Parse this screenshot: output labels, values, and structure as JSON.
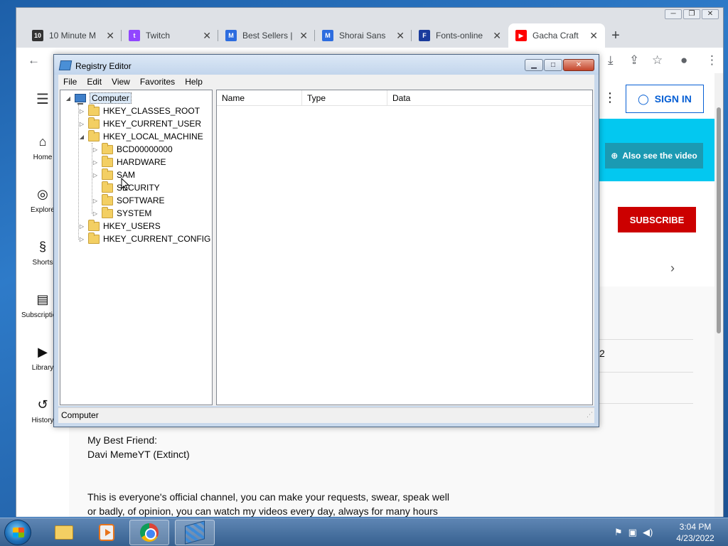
{
  "browser": {
    "tabs": [
      {
        "title": "10 Minute M",
        "icon_text": "10",
        "icon_color": "#333333"
      },
      {
        "title": "Twitch",
        "icon_text": "t",
        "icon_color": "#9146ff"
      },
      {
        "title": "Best Sellers |",
        "icon_text": "M",
        "icon_color": "#2d6cdf"
      },
      {
        "title": "Shorai Sans",
        "icon_text": "M",
        "icon_color": "#2d6cdf"
      },
      {
        "title": "Fonts-online",
        "icon_text": "F",
        "icon_color": "#1a3b9c"
      },
      {
        "title": "Gacha Craft",
        "icon_text": "▶",
        "icon_color": "#ff0000"
      }
    ],
    "newtab": "+"
  },
  "youtube": {
    "sidebar": [
      {
        "label": "Home",
        "icon": "⌂"
      },
      {
        "label": "Explore",
        "icon": "◎"
      },
      {
        "label": "Shorts",
        "icon": "§"
      },
      {
        "label": "Subscriptions",
        "icon": "▤"
      },
      {
        "label": "Library",
        "icon": "▶"
      },
      {
        "label": "History",
        "icon": "↺"
      }
    ],
    "sign_in": "SIGN IN",
    "also_see": "Also see the video",
    "subscribe": "SUBSCRIBE",
    "fragment": "2",
    "desc_lines": [
      "My Best Friend:",
      "Davi MemeYT (Extinct)",
      "This is everyone's official channel, you can make your requests, swear, speak well",
      "or badly, of opinion, you can watch my videos every day, always for many hours"
    ],
    "colors": {
      "subscribe": "#cc0000",
      "banner": "#03c8f0",
      "link": "#065fd4"
    }
  },
  "registry": {
    "title": "Registry Editor",
    "menu": [
      "File",
      "Edit",
      "View",
      "Favorites",
      "Help"
    ],
    "tree": {
      "root": "Computer",
      "hives": [
        "HKEY_CLASSES_ROOT",
        "HKEY_CURRENT_USER",
        "HKEY_LOCAL_MACHINE"
      ],
      "local_machine_children": [
        "BCD00000000",
        "HARDWARE",
        "SAM",
        "SECURITY",
        "SOFTWARE",
        "SYSTEM"
      ],
      "hives_after": [
        "HKEY_USERS",
        "HKEY_CURRENT_CONFIG"
      ]
    },
    "columns": [
      "Name",
      "Type",
      "Data"
    ],
    "status": "Computer"
  },
  "taskbar": {
    "time": "3:04 PM",
    "date": "4/23/2022"
  }
}
